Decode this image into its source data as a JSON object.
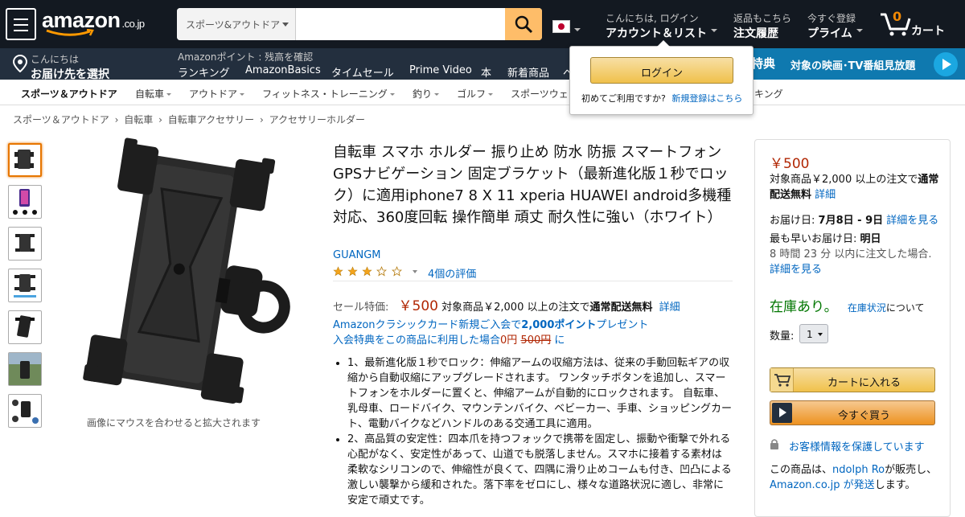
{
  "header": {
    "logo_text": "amazon",
    "logo_domain": ".co.jp",
    "search": {
      "category": "スポーツ&アウトドア",
      "value": "",
      "placeholder": ""
    },
    "account": {
      "line1": "こんにちは, ログイン",
      "line2": "アカウント＆リスト"
    },
    "orders": {
      "line1": "返品もこちら",
      "line2": "注文履歴"
    },
    "prime": {
      "line1": "今すぐ登録",
      "line2": "プライム"
    },
    "cart": {
      "count": "0",
      "label": "カート"
    },
    "icons": [
      "menu-icon",
      "search-icon",
      "flag-jp-icon",
      "cart-icon",
      "location-icon"
    ]
  },
  "subnav": {
    "location": {
      "line1": "こんにちは",
      "line2": "お届け先を選択"
    },
    "points_text": "Amazonポイント : 残高を確認",
    "links": [
      "ランキング",
      "AmazonBasics",
      "タイムセール",
      "Prime Video",
      "本",
      "新着商品"
    ],
    "promo_badge": "特典",
    "promo_text": "対象の映画･TV番組見放題"
  },
  "login_popup": {
    "button": "ログイン",
    "new_text": "初めてご利用ですか?",
    "register_link": "新規登録はこちら"
  },
  "category_nav": {
    "home": "スポーツ＆アウトドア",
    "items": [
      "自転車",
      "アウトドア",
      "フィットネス・トレーニング",
      "釣り",
      "ゴルフ",
      "スポーツウェ",
      "キング"
    ]
  },
  "breadcrumb": [
    "スポーツ＆アウトドア",
    "自転車",
    "自転車アクセサリー",
    "アクセサリーホルダー"
  ],
  "gallery": {
    "hover_text": "画像にマウスを合わせると拡大されます",
    "thumb_count": 7
  },
  "product": {
    "title": "自転車 スマホ ホルダー 振り止め 防水 防振 スマートフォンGPSナビゲーション 固定ブラケット（最新進化版１秒でロック）に適用iphone7 8 X 11 xperia HUAWEI android多機種対応、360度回転 操作簡単 頑丈 耐久性に強い（ホワイト）",
    "brand": "GUANGM",
    "rating": 3,
    "rating_text": "4個の評価",
    "price_label": "セール特価:",
    "price": "￥500",
    "shipping_pre": "対象商品￥2,000 以上の注文で",
    "shipping_bold": "通常配送無料",
    "details_link": "詳細",
    "promo_line1a": "Amazonクラシックカード新規ご入会で",
    "promo_line1b": "2,000ポイント",
    "promo_line1c": "プレゼント",
    "promo_line2a": "入会特典をこの商品に利用した場合",
    "promo_line2b": "0円",
    "promo_line2c": "500円",
    "promo_line2d": "に",
    "bullets": [
      "1、最新進化版１秒でロック：伸縮アームの収縮方法は、従来の手動回転ギアの収縮から自動収縮にアップグレードされます。 ワンタッチボタンを追加し、スマートフォンをホルダーに置くと、伸縮アームが自動的にロックされます。 自転車、乳母車、ロードバイク、マウンテンバイク、ベビーカー、手車、ショッピングカート、電動バイクなどハンドルのある交通工具に適用。",
      "2、高品質の安定性：四本爪を持つフォックで携帯を固定し、振動や衝撃で外れる心配がなく、安定性があって、山道でも脱落しません。スマホに接着する素材は柔軟なシリコンので、伸縮性が良くて、四隅に滑り止めコームも付き、凹凸による激しい襲撃から緩和された。落下率をゼロにし、様々な道路状況に適し、非常に安定で頑丈です。"
    ]
  },
  "buybox": {
    "price": "￥500",
    "shipping_pre": "対象商品￥2,000 以上の注文で",
    "shipping_bold": "通常配送無料",
    "details_link": "詳細",
    "delivery_label": "お届け日:",
    "delivery_date": "7月8日 - 9日",
    "delivery_link": "詳細を見る",
    "earliest_label": "最も早いお届け日:",
    "earliest_day": "明日",
    "earliest_cond": "8 時間 23 分 以内に注文した場合.",
    "earliest_link": "詳細を見る",
    "stock": "在庫あり。",
    "stock_link": "在庫状況",
    "stock_suffix": "について",
    "qty_label": "数量:",
    "qty_value": "1",
    "add_to_cart": "カートに入れる",
    "buy_now": "今すぐ買う",
    "secure_text": "お客様情報を保護しています",
    "seller_pre": "この商品は、",
    "seller_name": "ndolph Ro",
    "seller_mid": "が販売し、",
    "ship_by": "Amazon.co.jp が発送",
    "seller_end": "します。"
  },
  "colors": {
    "header": "#131921",
    "subnav": "#232f3e",
    "accent": "#febd69",
    "price": "#b12704",
    "link": "#0066c0",
    "stock": "#007600"
  }
}
